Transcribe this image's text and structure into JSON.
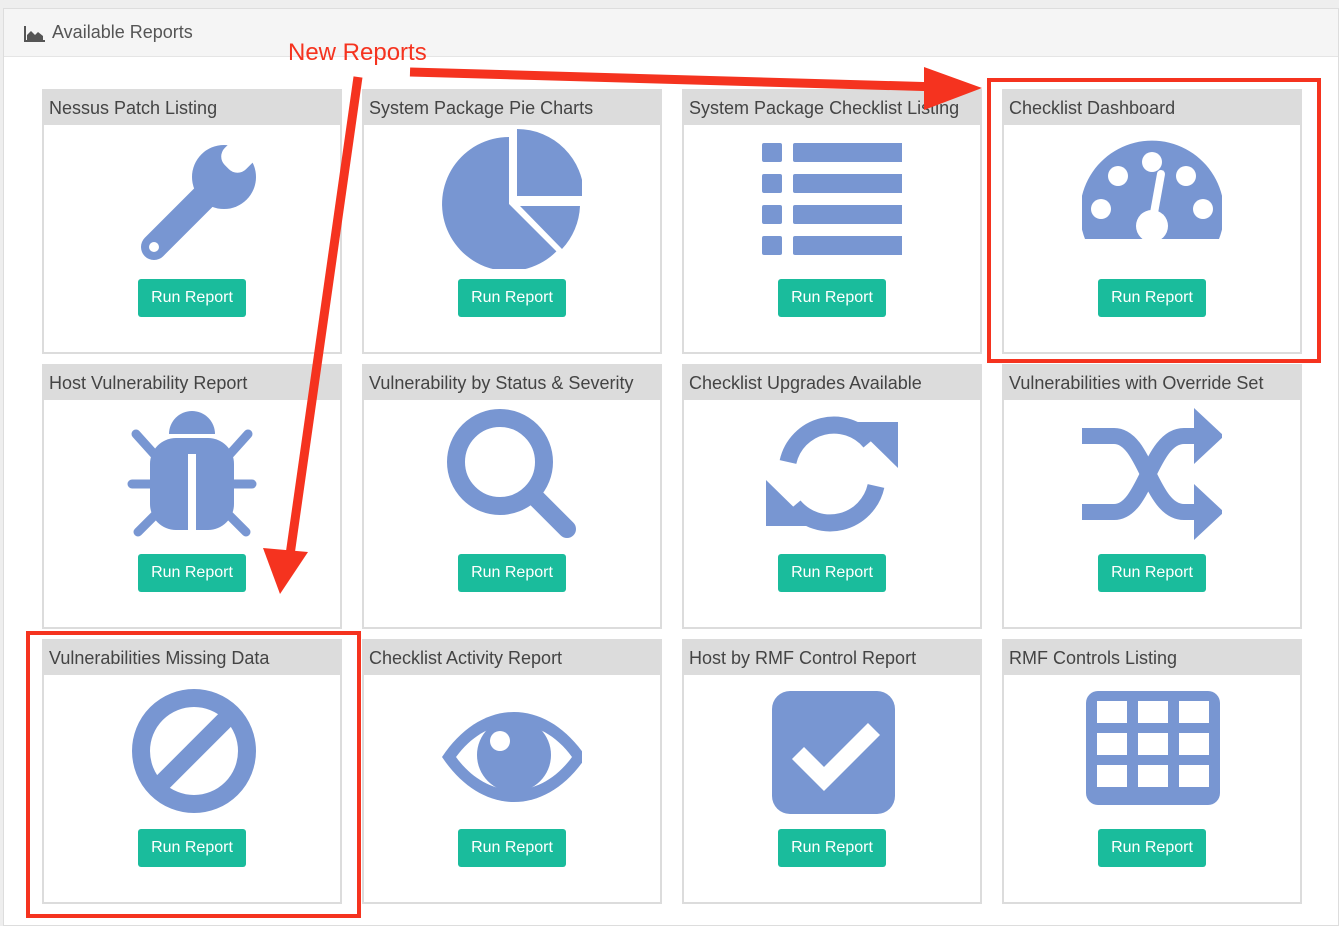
{
  "panel": {
    "title": "Available Reports",
    "icon": "area-chart-icon"
  },
  "annotation": {
    "text": "New Reports",
    "color": "#f5331f"
  },
  "theme": {
    "accent": "#1abc9c",
    "icon_color": "#7896d2",
    "card_header_bg": "#dcdcdc"
  },
  "reports": [
    {
      "title": "Nessus Patch Listing",
      "icon": "wrench-icon",
      "button": "Run Report"
    },
    {
      "title": "System Package Pie Charts",
      "icon": "pie-chart-icon",
      "button": "Run Report"
    },
    {
      "title": "System Package Checklist Listing",
      "icon": "list-icon",
      "button": "Run Report"
    },
    {
      "title": "Checklist Dashboard",
      "icon": "dashboard-icon",
      "button": "Run Report"
    },
    {
      "title": "Host Vulnerability Report",
      "icon": "bug-icon",
      "button": "Run Report"
    },
    {
      "title": "Vulnerability by Status & Severity",
      "icon": "search-icon",
      "button": "Run Report"
    },
    {
      "title": "Checklist Upgrades Available",
      "icon": "refresh-icon",
      "button": "Run Report"
    },
    {
      "title": "Vulnerabilities with Override Set",
      "icon": "shuffle-icon",
      "button": "Run Report"
    },
    {
      "title": "Vulnerabilities Missing Data",
      "icon": "ban-icon",
      "button": "Run Report"
    },
    {
      "title": "Checklist Activity Report",
      "icon": "eye-icon",
      "button": "Run Report"
    },
    {
      "title": "Host by RMF Control Report",
      "icon": "checkbox-icon",
      "button": "Run Report"
    },
    {
      "title": "RMF Controls Listing",
      "icon": "table-icon",
      "button": "Run Report"
    }
  ]
}
